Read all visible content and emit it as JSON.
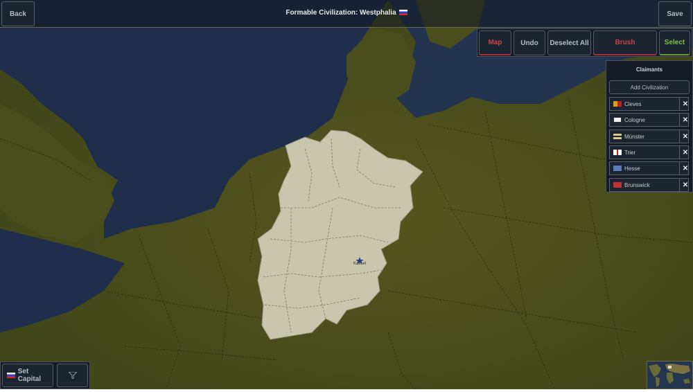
{
  "header": {
    "back_label": "Back",
    "title": "Formable Civilization: Westphalia",
    "title_flag_icon": "russian-tricolor-flag",
    "save_label": "Save"
  },
  "toolbar": {
    "map_label": "Map",
    "undo_label": "Undo",
    "deselect_all_label": "Deselect All",
    "brush_label": "Brush",
    "select_label": "Select"
  },
  "claimants": {
    "title": "Claimants",
    "add_label": "Add Civilization",
    "items": [
      {
        "name": "Cleves",
        "flag_icon": "cleves-flag"
      },
      {
        "name": "Cologne",
        "flag_icon": "cologne-flag"
      },
      {
        "name": "Münster",
        "flag_icon": "munster-flag"
      },
      {
        "name": "Trier",
        "flag_icon": "trier-flag"
      },
      {
        "name": "Hesse",
        "flag_icon": "hesse-flag"
      },
      {
        "name": "Brunswick",
        "flag_icon": "brunswick-flag"
      }
    ],
    "remove_icon": "close-icon"
  },
  "map": {
    "capital_label": "Kassel"
  },
  "bottom": {
    "set_capital_label": "Set Capital",
    "filter_icon": "filter-icon"
  },
  "colors": {
    "land": "#4c4e1e",
    "sea": "#1f2e4a",
    "selected_region": "#c8c6ac",
    "map_accent": "#a8323a",
    "select_accent": "#5fa030"
  }
}
